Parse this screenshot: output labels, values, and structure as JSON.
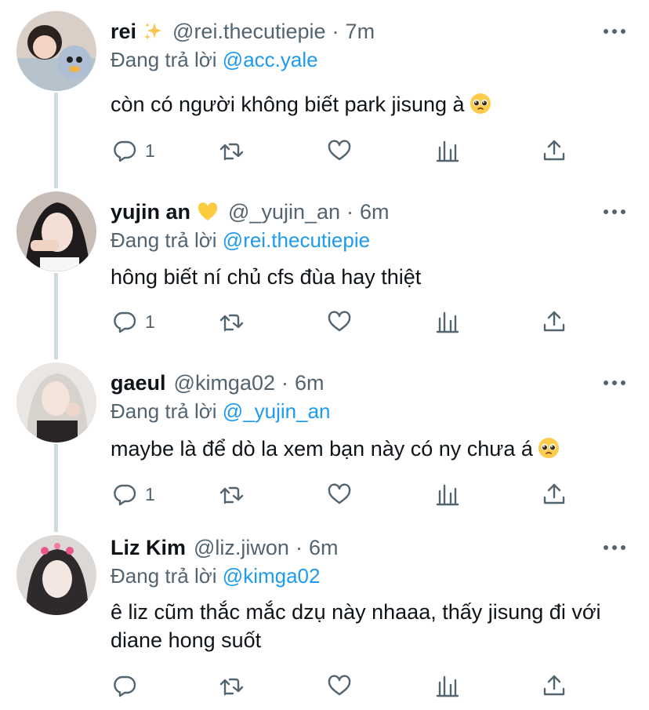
{
  "reply_prefix": "Đang trả lời",
  "tweets": [
    {
      "name": "rei",
      "name_emoji": "sparkles-emoji",
      "handle": "@rei.thecutiepie",
      "time": "7m",
      "reply_to": "@acc.yale",
      "text": "còn có người không biết park jisung à",
      "text_emoji": "pleading-face-emoji",
      "reply_count": "1"
    },
    {
      "name": "yujin an",
      "name_emoji": "yellow-heart-emoji",
      "handle": "@_yujin_an",
      "time": "6m",
      "reply_to": "@rei.thecutiepie",
      "text": "hông biết ní chủ cfs đùa hay thiệt",
      "reply_count": "1"
    },
    {
      "name": "gaeul",
      "handle": "@kimga02",
      "time": "6m",
      "reply_to": "@_yujin_an",
      "text": "maybe là để dò la xem bạn này có ny chưa á",
      "text_emoji": "pleading-face-emoji",
      "reply_count": "1"
    },
    {
      "name": "Liz Kim",
      "handle": "@liz.jiwon",
      "time": "6m",
      "reply_to": "@kimga02",
      "text": "ê liz cũm thắc mắc dzụ này nhaaa, thấy jisung đi với diane hong suốt",
      "reply_count": ""
    }
  ],
  "colors": {
    "text": "#0f1419",
    "secondary": "#536471",
    "link": "#1d9bf0",
    "thread_line": "#cfd9de"
  },
  "icons": [
    "reply-icon",
    "retweet-icon",
    "like-icon",
    "analytics-icon",
    "share-icon",
    "more-icon"
  ]
}
